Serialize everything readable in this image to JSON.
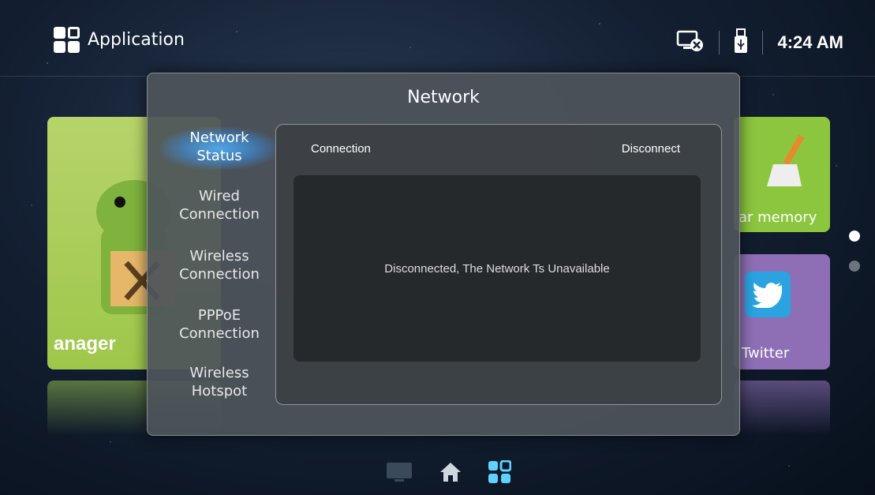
{
  "header": {
    "app_title": "Application",
    "time": "4:24 AM",
    "icons": [
      "network-disconnected-icon",
      "usb-icon"
    ]
  },
  "background_tiles": {
    "manager_label": "anager",
    "clear_memory_label": "ar memory",
    "twitter_label": "Twitter"
  },
  "dialog": {
    "title": "Network",
    "menu": [
      {
        "line1": "Network",
        "line2": "Status"
      },
      {
        "line1": "Wired",
        "line2": "Connection"
      },
      {
        "line1": "Wireless",
        "line2": "Connection"
      },
      {
        "line1": "PPPoE",
        "line2": "Connection"
      },
      {
        "line1": "Wireless",
        "line2": "Hotspot"
      }
    ],
    "panel": {
      "connection_label": "Connection",
      "disconnect_label": "Disconnect",
      "status_message": "Disconnected, The Network Ts Unavailable"
    }
  },
  "bottom_nav": [
    "tv-icon",
    "home-icon",
    "apps-icon"
  ],
  "colors": {
    "accent": "#3aa0e8",
    "dialog_bg": "#4e545a",
    "status_box_bg": "#26292c"
  }
}
